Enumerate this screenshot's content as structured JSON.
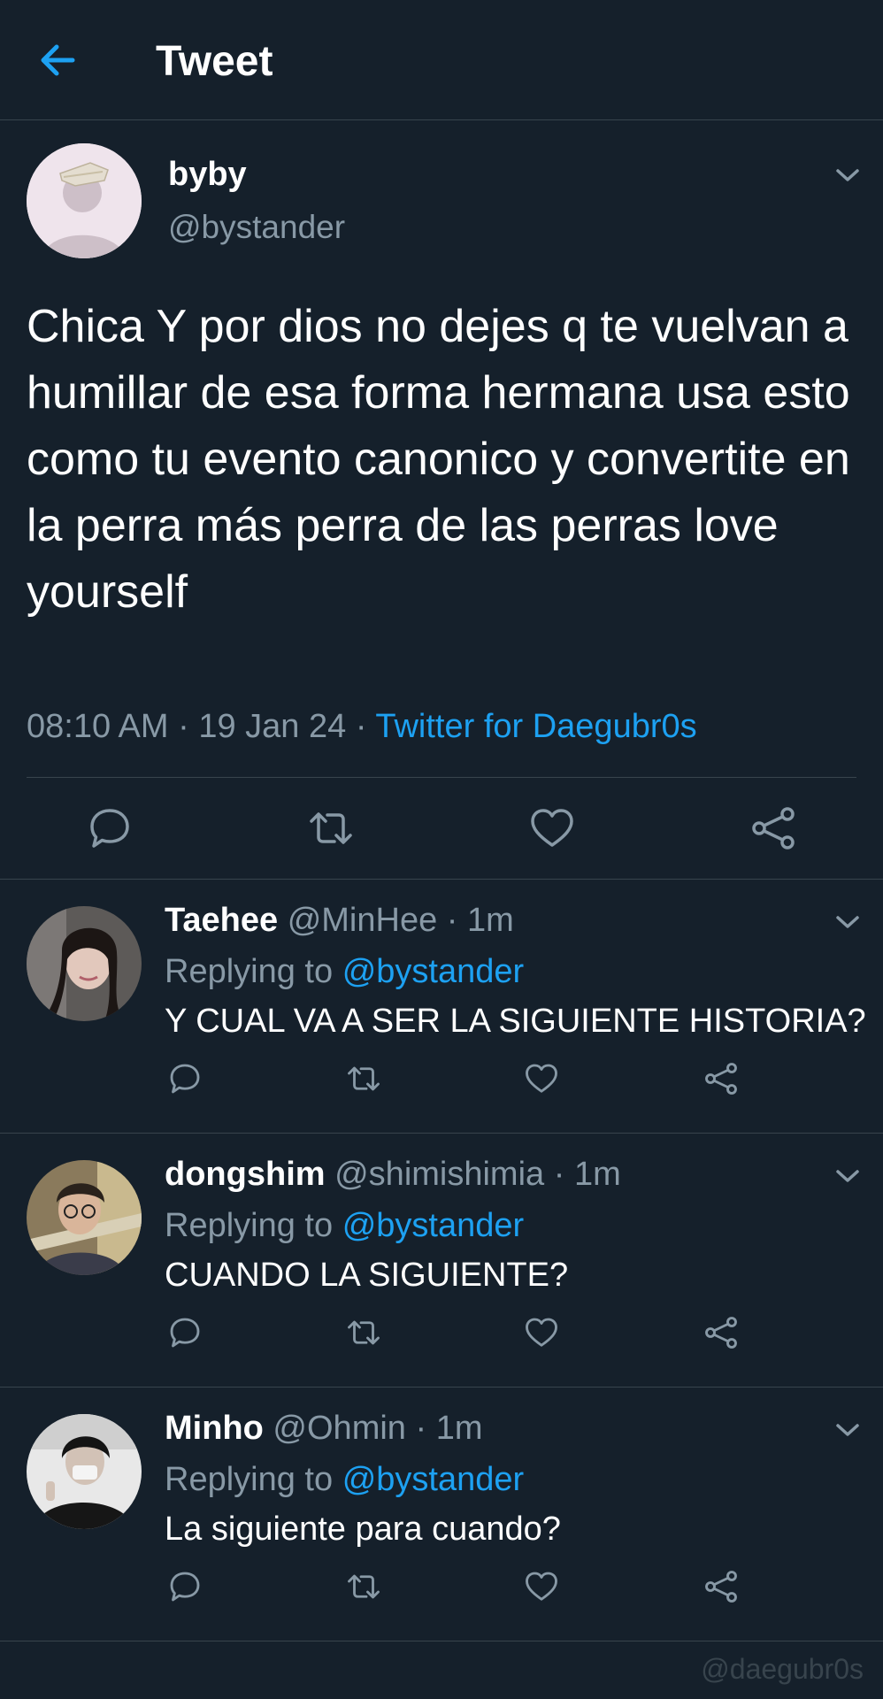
{
  "header": {
    "title": "Tweet",
    "back_icon": "arrow-left-icon"
  },
  "colors": {
    "background": "#15202b",
    "accent": "#1da1f2",
    "secondary_text": "#8899a6",
    "divider": "#38444d"
  },
  "main_tweet": {
    "name": "byby",
    "handle": "@bystander",
    "text": "Chica Y por dios no dejes q te vuelvan a humillar de esa forma hermana usa esto como tu evento canonico y convertite en la perra más perra de las perras love yourself",
    "time": "08:10 AM",
    "date": "19 Jan 24",
    "separator": "·",
    "source": "Twitter for Daegubr0s"
  },
  "replies": [
    {
      "name": "Taehee",
      "handle": "@MinHee",
      "time": "· 1m",
      "replying_label": "Replying to",
      "replying_to": "@bystander",
      "text": "Y CUAL VA A SER LA SIGUIENTE HISTORIA?"
    },
    {
      "name": "dongshim",
      "handle": "@shimishimia",
      "time": "· 1m",
      "replying_label": "Replying to",
      "replying_to": "@bystander",
      "text": "CUANDO LA SIGUIENTE?"
    },
    {
      "name": "Minho",
      "handle": "@Ohmin",
      "time": "· 1m",
      "replying_label": "Replying to",
      "replying_to": "@bystander",
      "text": "La siguiente para cuando?"
    }
  ],
  "watermark": "@daegubr0s"
}
